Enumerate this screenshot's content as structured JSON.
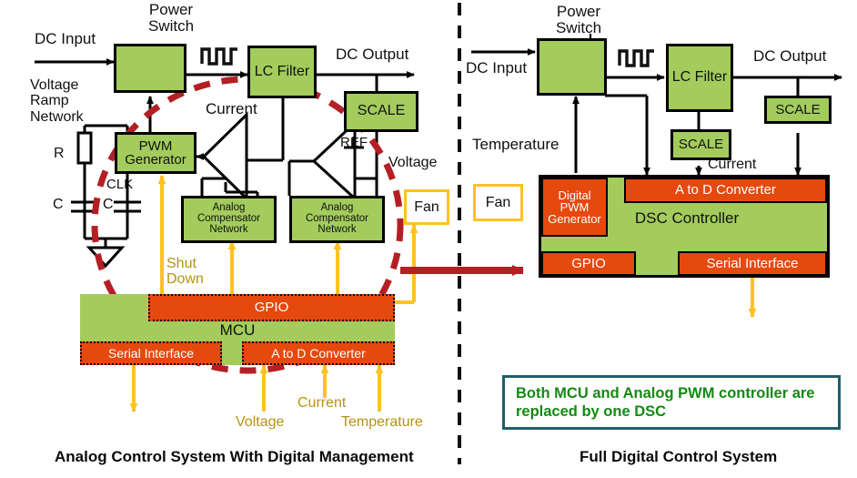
{
  "left": {
    "caption": "Analog Control System With Digital Management",
    "labels": {
      "dc_input": "DC Input",
      "power_switch": "Power Switch",
      "voltage_ramp_network": "Voltage Ramp Network",
      "r": "R",
      "c1": "C",
      "c2": "C",
      "clk": "CLK",
      "dc_output": "DC Output",
      "current": "Current",
      "ref": "REF",
      "voltage": "Voltage",
      "shut_down": "Shut Down",
      "adc_voltage": "Voltage",
      "adc_current": "Current",
      "adc_temperature": "Temperature"
    },
    "blocks": {
      "power_switch": "",
      "pwm_generator": "PWM Generator",
      "lc_filter": "LC Filter",
      "scale": "SCALE",
      "comp_net_1": "Analog Compensator Network",
      "comp_net_2": "Analog Compensator Network",
      "fan": "Fan",
      "mcu": "MCU",
      "gpio": "GPIO",
      "serial_interface": "Serial Interface",
      "adc": "A to D Converter"
    }
  },
  "right": {
    "caption": "Full Digital Control System",
    "labels": {
      "dc_input": "DC Input",
      "power_switch": "Power Switch",
      "dc_output": "DC Output",
      "temperature": "Temperature",
      "current": "Current"
    },
    "blocks": {
      "lc_filter": "LC Filter",
      "scale_out": "SCALE",
      "scale_current": "SCALE",
      "fan": "Fan",
      "digital_pwm_generator": "Digital PWM Generator",
      "adc": "A to D Converter",
      "dsc_controller": "DSC Controller",
      "gpio": "GPIO",
      "serial_interface": "Serial Interface"
    },
    "note": "Both MCU and Analog PWM controller are replaced by one DSC"
  },
  "colors": {
    "green": "#a3cc5c",
    "orange": "#e5490e",
    "yellow": "#ffc222",
    "yellow_text": "#b69310",
    "red_dashed": "#b41f24",
    "note_border": "#1e5f6b",
    "note_text": "#138a13",
    "black": "#000000"
  },
  "icons": {
    "mosfet": "mosfet-symbol-icon",
    "pulse_left": "pwm-pulse-waveform-icon",
    "pulse_right": "pwm-pulse-waveform-icon",
    "ground": "ground-symbol-icon",
    "divider": "vertical-dashed-divider-icon",
    "highlight_ellipse": "red-dashed-ellipse-icon",
    "transition_arrow": "red-transition-arrow-icon"
  }
}
